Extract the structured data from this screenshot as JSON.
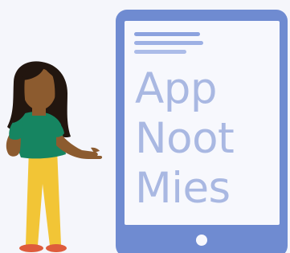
{
  "illustration": {
    "tablet_text": {
      "line1": "App",
      "line2": "Noot",
      "line3": "Mies"
    },
    "colors": {
      "background": "#f5f6fb",
      "tablet_frame": "#6f8bd1",
      "tablet_screen": "#f7f8fd",
      "screen_text": "#a9b8e2",
      "person_skin": "#8c5b2f",
      "person_hair": "#22160f",
      "person_shirt": "#168561",
      "person_pants": "#f2c536",
      "person_shoes": "#de5c3c"
    },
    "icons": {
      "home_button": "circle-button-icon",
      "text_lines": "text-lines-icon"
    }
  }
}
